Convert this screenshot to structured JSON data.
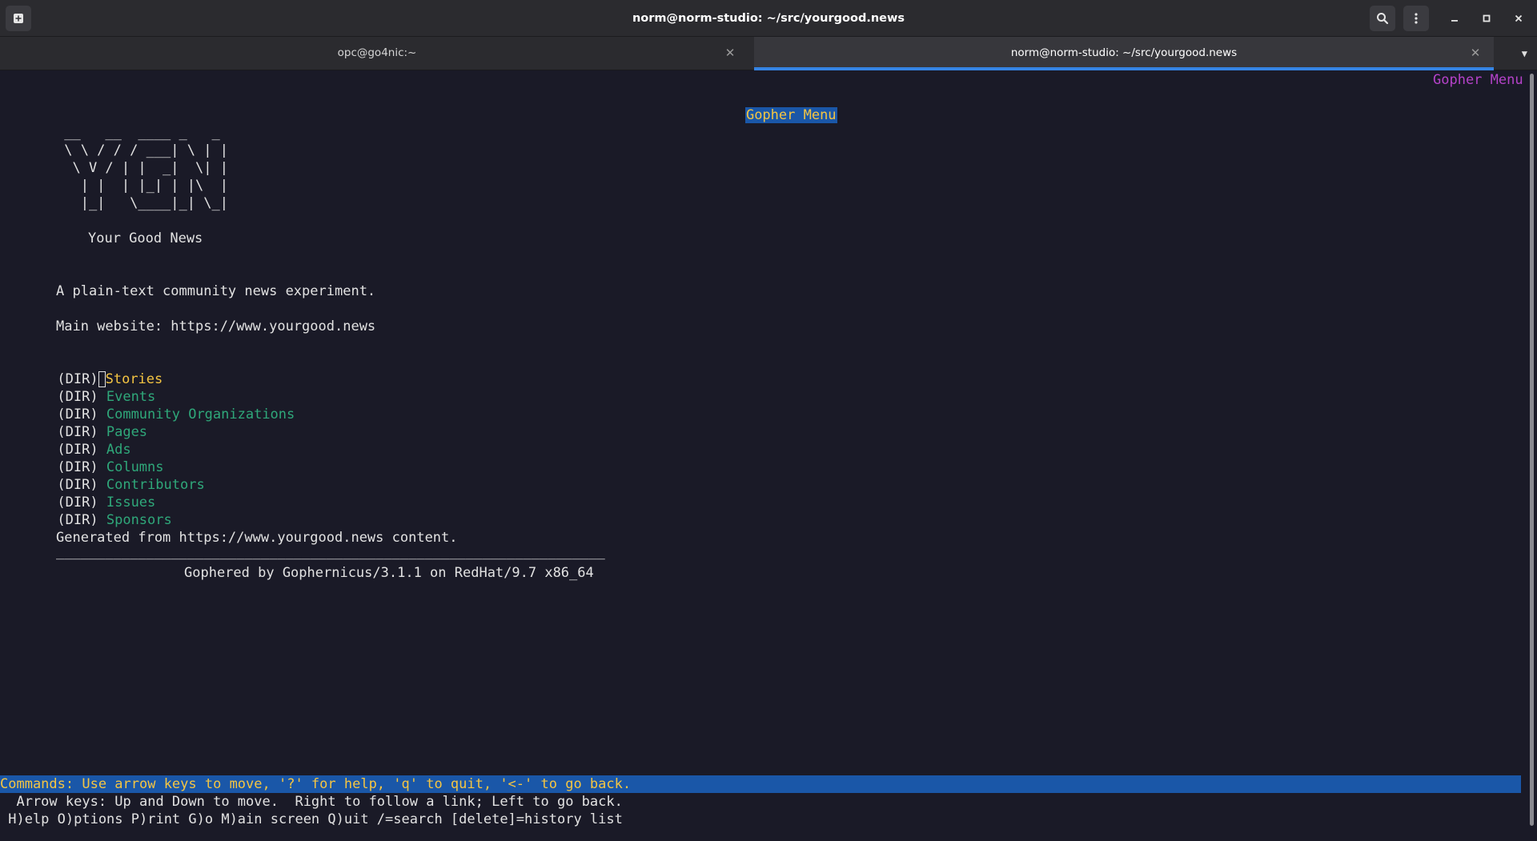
{
  "window": {
    "title": "norm@norm-studio: ~/src/yourgood.news"
  },
  "tabs": [
    {
      "label": "opc@go4nic:~",
      "active": false
    },
    {
      "label": "norm@norm-studio: ~/src/yourgood.news",
      "active": true
    }
  ],
  "terminal": {
    "menu_title": "Gopher Menu",
    "corner_title": "Gopher Menu",
    "logo_lines": [
      " __   __  ____ _   _",
      " \\ \\ / / / ___| \\ | |",
      "  \\ V / | |  _|  \\| |",
      "   | |  | |_| | |\\  |",
      "   |_|   \\____|_| \\_|"
    ],
    "tagline": "Your Good News",
    "description": "A plain-text community news experiment.",
    "website": "Main website: https://www.yourgood.news",
    "dir_prefix": "(DIR)",
    "items": [
      {
        "label": "Stories",
        "selected": true
      },
      {
        "label": "Events",
        "selected": false
      },
      {
        "label": "Community Organizations",
        "selected": false
      },
      {
        "label": "Pages",
        "selected": false
      },
      {
        "label": "Ads",
        "selected": false
      },
      {
        "label": "Columns",
        "selected": false
      },
      {
        "label": "Contributors",
        "selected": false
      },
      {
        "label": "Issues",
        "selected": false
      },
      {
        "label": "Sponsors",
        "selected": false
      }
    ],
    "generated": "Generated from https://www.yourgood.news content.",
    "rule": "___________________________________________________________________",
    "footer": "Gophered by Gophernicus/3.1.1 on RedHat/9.7 x86_64",
    "status_line": "Commands: Use arrow keys to move, '?' for help, 'q' to quit, '<-' to go back.",
    "help_line1": "  Arrow keys: Up and Down to move.  Right to follow a link; Left to go back.",
    "help_line2": " H)elp O)ptions P)rint G)o M)ain screen Q)uit /=search [delete]=history list"
  },
  "colors": {
    "background": "#1a1a27",
    "link": "#2fa87a",
    "selected_link": "#f5c542",
    "status_bar": "#1a57a8",
    "corner_title": "#b542c9",
    "tab_indicator": "#3584e4"
  },
  "icons": {
    "new_tab": "new-tab-icon",
    "search": "search-icon",
    "menu": "kebab-menu-icon",
    "minimize": "minimize-icon",
    "maximize": "maximize-icon",
    "close": "close-icon",
    "tab_list": "chevron-down-icon"
  }
}
